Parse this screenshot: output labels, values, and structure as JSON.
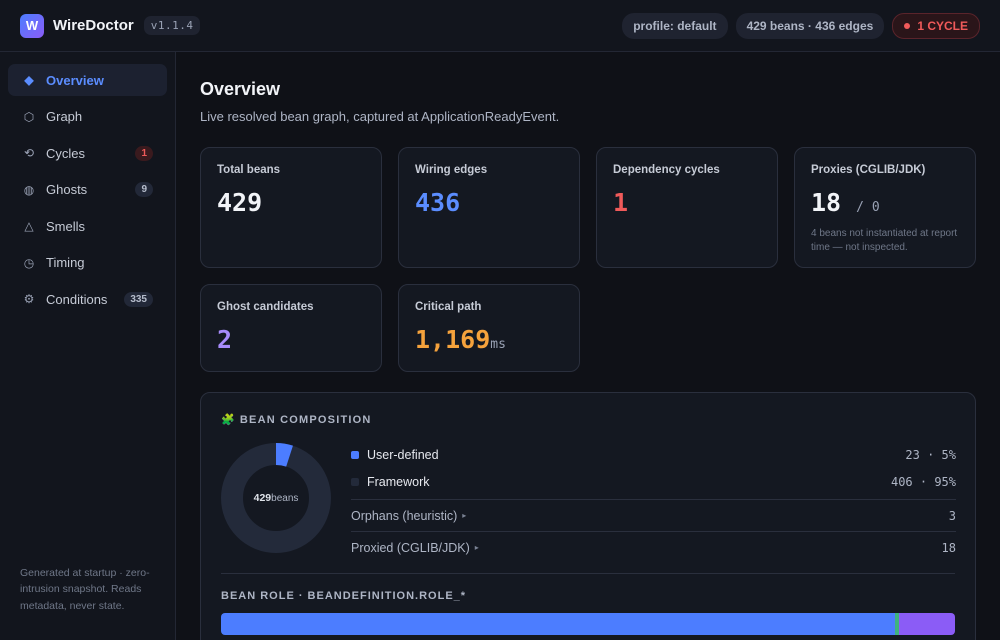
{
  "app": {
    "name": "WireDoctor",
    "logo_letter": "W",
    "version": "v1.1.4"
  },
  "header": {
    "profile": "profile: default",
    "stats": "429 beans · 436 edges",
    "cycle_badge": "1 CYCLE"
  },
  "sidebar": {
    "items": [
      {
        "label": "Overview",
        "icon": "diamond-icon",
        "glyph": "◆",
        "badge": ""
      },
      {
        "label": "Graph",
        "icon": "hexagon-icon",
        "glyph": "⬡",
        "badge": ""
      },
      {
        "label": "Cycles",
        "icon": "cycle-icon",
        "glyph": "⟲",
        "badge": "1"
      },
      {
        "label": "Ghosts",
        "icon": "ghost-icon",
        "glyph": "◍",
        "badge": "9"
      },
      {
        "label": "Smells",
        "icon": "triangle-icon",
        "glyph": "△",
        "badge": ""
      },
      {
        "label": "Timing",
        "icon": "clock-icon",
        "glyph": "◷",
        "badge": ""
      },
      {
        "label": "Conditions",
        "icon": "gear-icon",
        "glyph": "⚙",
        "badge": "335"
      }
    ],
    "footer": "Generated at startup · zero-intrusion snapshot. Reads metadata, never state."
  },
  "main": {
    "title": "Overview",
    "subtitle": "Live resolved bean graph, captured at ApplicationReadyEvent.",
    "cards": {
      "total_beans": {
        "label": "Total beans",
        "value": "429"
      },
      "wiring_edges": {
        "label": "Wiring edges",
        "value": "436"
      },
      "cycles": {
        "label": "Dependency cycles",
        "value": "1"
      },
      "proxies": {
        "label": "Proxies (CGLIB/JDK)",
        "value": "18",
        "secondary": "/ 0",
        "note": "4 beans not instantiated at report time — not inspected."
      },
      "ghosts": {
        "label": "Ghost candidates",
        "value": "2"
      },
      "critical": {
        "label": "Critical path",
        "value": "1,169",
        "unit": "ms"
      }
    },
    "composition": {
      "title": "BEAN COMPOSITION",
      "icon": "puzzle-icon",
      "center_value": "429",
      "center_label": "beans",
      "user_fraction": 0.05,
      "rows": [
        {
          "label": "User-defined",
          "value": "23 · 5%",
          "color": "#4c7dff"
        },
        {
          "label": "Framework",
          "value": "406 · 95%",
          "color": "#232a3a"
        }
      ],
      "sub_rows": [
        {
          "label": "Orphans (heuristic)",
          "value": "3"
        },
        {
          "label": "Proxied (CGLIB/JDK)",
          "value": "18"
        }
      ],
      "role_title": "BEAN ROLE · BEANDEFINITION.ROLE_*",
      "role_segments": [
        {
          "fraction": 0.918,
          "color": "#4c7dff"
        },
        {
          "fraction": 0.006,
          "color": "#3fb37f"
        },
        {
          "fraction": 0.076,
          "color": "#8b5cf6"
        }
      ]
    }
  },
  "colors": {
    "accent": "#4c7dff",
    "danger": "#f05a5a",
    "purple": "#a78bfa",
    "orange": "#f5a23c"
  }
}
